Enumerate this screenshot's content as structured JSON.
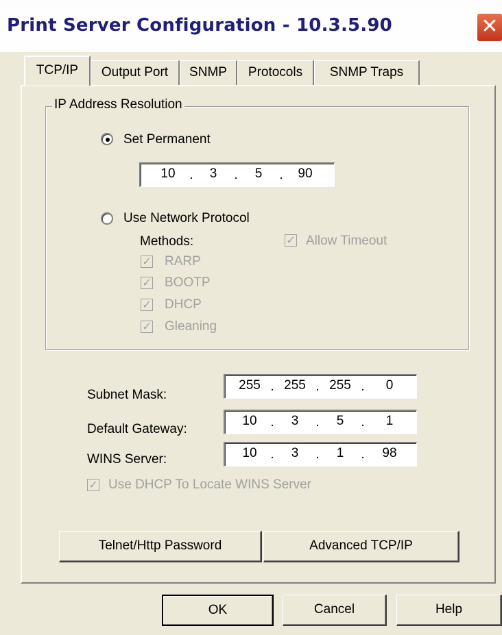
{
  "window": {
    "title": "Print Server Configuration - 10.3.5.90",
    "close_label": "✕"
  },
  "tabs": [
    {
      "label": "TCP/IP",
      "active": true
    },
    {
      "label": "Output Port"
    },
    {
      "label": "SNMP"
    },
    {
      "label": "Protocols"
    },
    {
      "label": "SNMP Traps"
    }
  ],
  "ip_resolution": {
    "group_label": "IP Address Resolution",
    "set_permanent_label": "Set Permanent",
    "set_permanent_selected": true,
    "permanent_ip": [
      "10",
      "3",
      "5",
      "90"
    ],
    "use_network_protocol_label": "Use Network Protocol",
    "methods_label": "Methods:",
    "allow_timeout_label": "Allow Timeout",
    "methods": [
      {
        "label": "RARP",
        "checked": true
      },
      {
        "label": "BOOTP",
        "checked": true
      },
      {
        "label": "DHCP",
        "checked": true
      },
      {
        "label": "Gleaning",
        "checked": true
      }
    ]
  },
  "network": {
    "subnet_mask_label": "Subnet Mask:",
    "subnet_mask": [
      "255",
      "255",
      "255",
      "0"
    ],
    "default_gateway_label": "Default Gateway:",
    "default_gateway": [
      "10",
      "3",
      "5",
      "1"
    ],
    "wins_server_label": "WINS Server:",
    "wins_server": [
      "10",
      "3",
      "1",
      "98"
    ],
    "use_dhcp_wins_label": "Use DHCP To Locate WINS Server"
  },
  "buttons": {
    "telnet_password": "Telnet/Http Password",
    "advanced_tcpip": "Advanced TCP/IP",
    "ok": "OK",
    "cancel": "Cancel",
    "help": "Help"
  },
  "colors": {
    "window_bg": "#ece9d8",
    "title_text": "#1f1f7a",
    "close_button": "#d9482a",
    "disabled_text": "#a0a0a0"
  }
}
